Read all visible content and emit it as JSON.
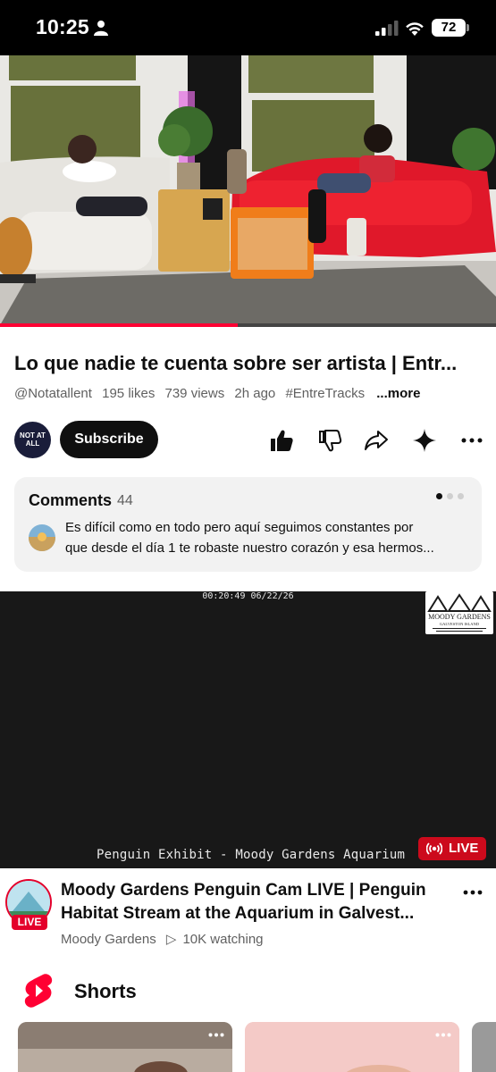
{
  "status_bar": {
    "time": "10:25",
    "battery": "72"
  },
  "video": {
    "title": "Lo que nadie te cuenta sobre ser artista | Entr...",
    "channel_handle": "@Notatallent",
    "likes": "195 likes",
    "views": "739 views",
    "age": "2h ago",
    "hashtag": "#EntreTracks",
    "more_label": "...more",
    "channel_avatar_text": "NOT AT ALL",
    "subscribe_label": "Subscribe",
    "progress_fraction": 0.48
  },
  "comments": {
    "title": "Comments",
    "count": "44",
    "line1": "Es difícil como en todo pero aquí seguimos constantes por",
    "line2": "que desde el día 1 te robaste nuestro corazón y esa hermos..."
  },
  "live_video": {
    "cam_timestamp": "00:20:49 06/22/26",
    "logo_text": "MOODY GARDENS",
    "logo_subtext": "GALVESTON ISLAND",
    "caption": "Penguin Exhibit - Moody Gardens Aquarium",
    "live_badge": "LIVE",
    "avatar_badge": "LIVE",
    "title_line1": "Moody Gardens Penguin Cam LIVE | Penguin",
    "title_line2": "Habitat Stream at the Aquarium in Galvest...",
    "channel": "Moody Gardens",
    "watching": "10K watching"
  },
  "shorts": {
    "title": "Shorts"
  },
  "colors": {
    "accent_red": "#ff0033",
    "live_red": "#cc0a1c",
    "text": "#0f0f0f",
    "secondary_text": "#606060"
  }
}
